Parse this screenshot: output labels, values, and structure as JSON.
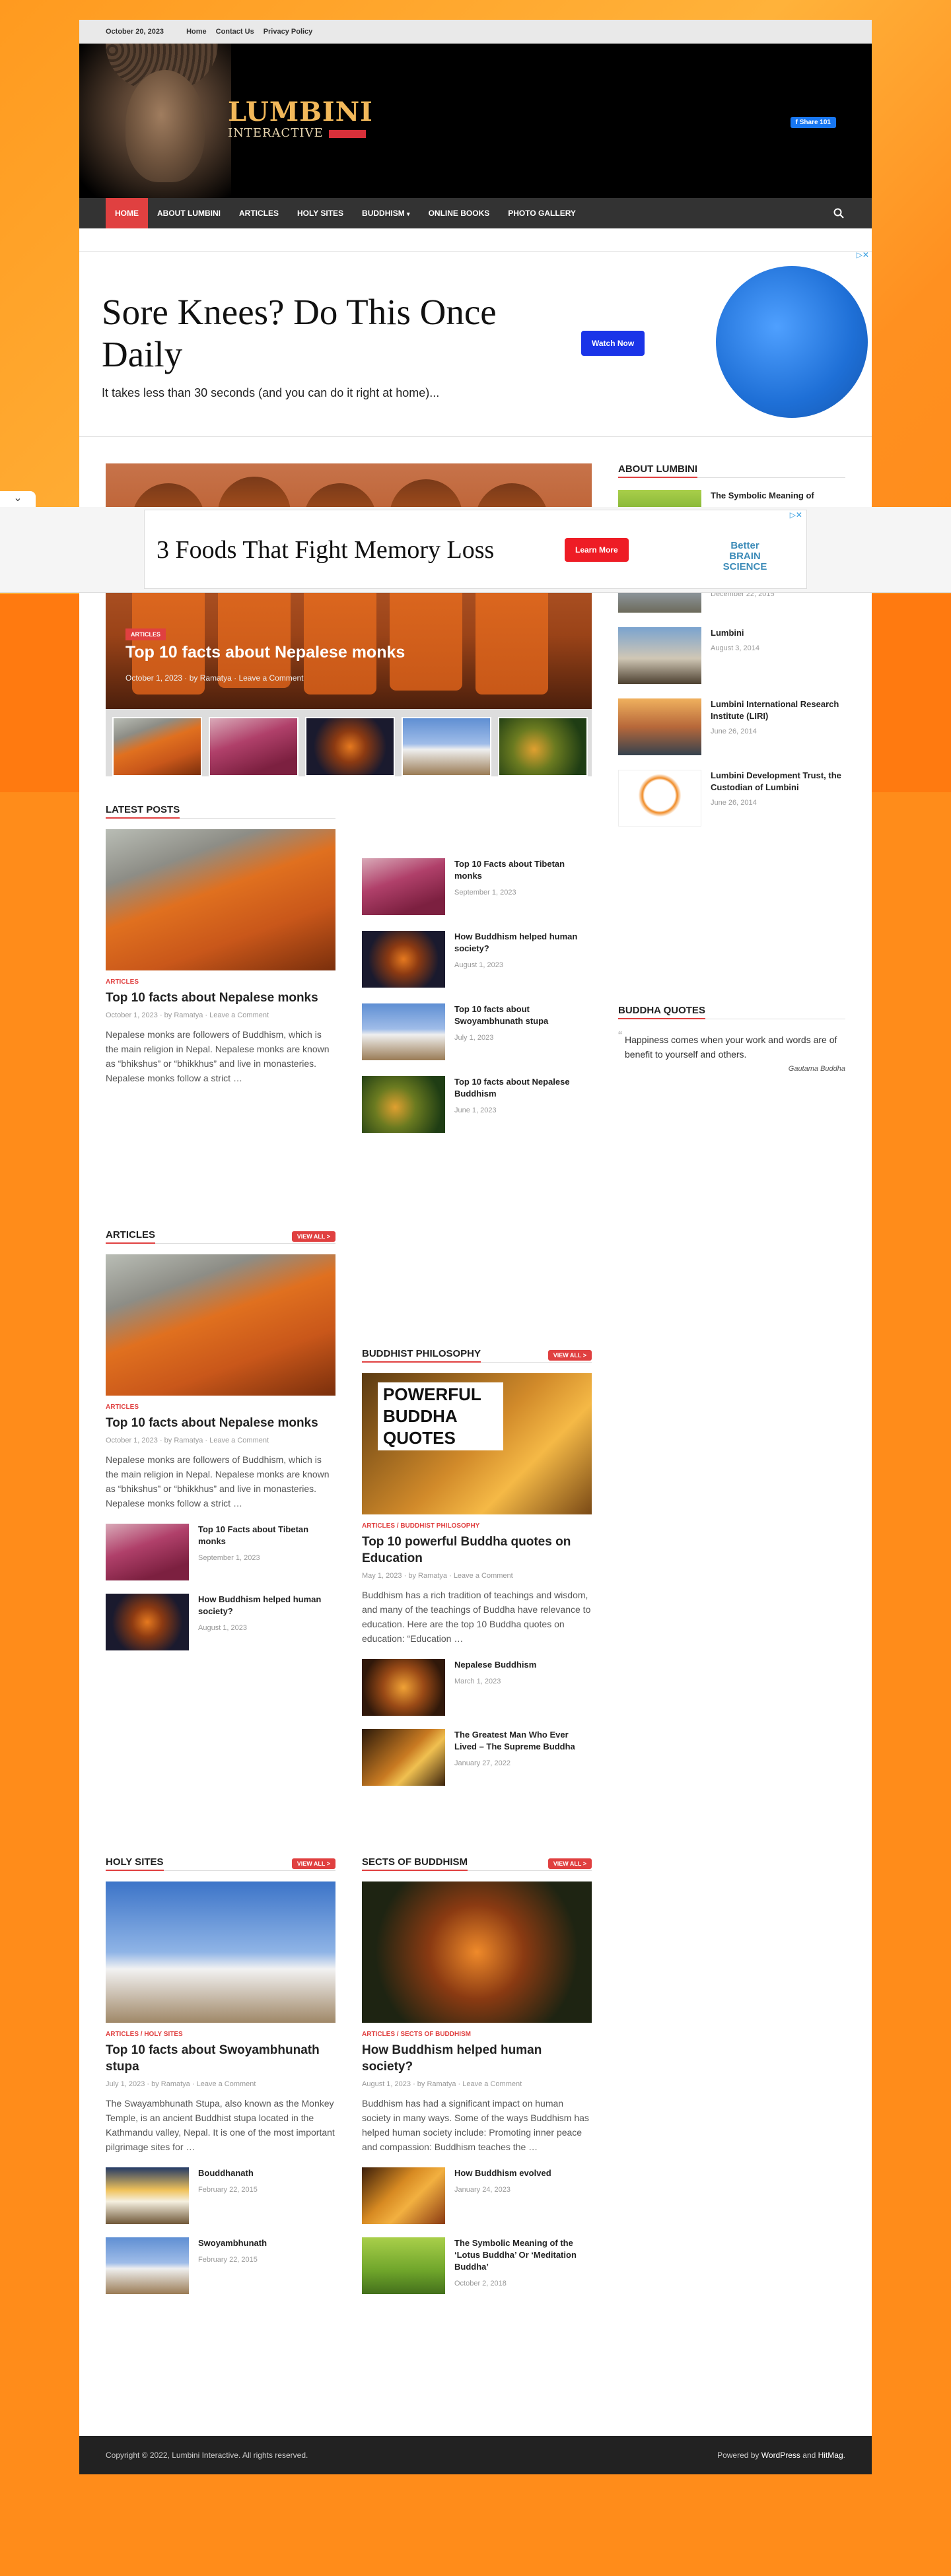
{
  "topbar": {
    "date": "October 20, 2023",
    "links": [
      "Home",
      "Contact Us",
      "Privacy Policy"
    ]
  },
  "header": {
    "logo_line1": "LUMBINI",
    "logo_line2": "INTERACTIVE",
    "share_label": "Share 101"
  },
  "nav": {
    "items": [
      "HOME",
      "ABOUT LUMBINI",
      "ARTICLES",
      "HOLY SITES",
      "BUDDHISM",
      "ONLINE BOOKS",
      "PHOTO GALLERY"
    ],
    "dropdown_icon": "chevron-down-icon",
    "search_icon": "search-icon"
  },
  "ad_top": {
    "headline": "Sore Knees? Do This Once Daily",
    "sub": "It takes less than 30 seconds (and you can do it right at home)...",
    "button": "Watch Now"
  },
  "hero": {
    "category": "ARTICLES",
    "title": "Top 10 facts about Nepalese monks",
    "date": "October 1, 2023",
    "author": "by Ramatya",
    "comment": "Leave a Comment"
  },
  "ad_overlay": {
    "headline": "3 Foods That Fight Memory Loss",
    "button": "Learn More",
    "brand": "Better BRAIN SCIENCE"
  },
  "sidebar": {
    "about_title": "ABOUT LUMBINI",
    "about_items": [
      {
        "title": "The Symbolic Meaning of",
        "date": ""
      },
      {
        "title": "",
        "date": "December 22, 2015"
      },
      {
        "title": "Lumbini",
        "date": "August 3, 2014"
      },
      {
        "title": "Lumbini International Research Institute (LIRI)",
        "date": "June 26, 2014"
      },
      {
        "title": "Lumbini Development Trust, the Custodian of Lumbini",
        "date": "June 26, 2014"
      }
    ],
    "quotes_title": "BUDDHA QUOTES",
    "quote_text": "Happiness comes when your work and words are of benefit to yourself and others.",
    "quote_author": "Gautama Buddha"
  },
  "latest": {
    "title": "LATEST POSTS",
    "main": {
      "category": "ARTICLES",
      "title": "Top 10 facts about Nepalese monks",
      "date": "October 1, 2023",
      "author": "by Ramatya",
      "comment": "Leave a Comment",
      "excerpt": "Nepalese monks are followers of Buddhism, which is the main religion in Nepal. Nepalese monks are known as “bhikshus” or “bhikkhus” and live in monasteries. Nepalese monks follow a strict …"
    },
    "list": [
      {
        "title": "Top 10 Facts about Tibetan monks",
        "date": "September 1, 2023"
      },
      {
        "title": "How Buddhism helped human society?",
        "date": "August 1, 2023"
      },
      {
        "title": "Top 10 facts about Swoyambhunath stupa",
        "date": "July 1, 2023"
      },
      {
        "title": "Top 10 facts about Nepalese Buddhism",
        "date": "June 1, 2023"
      }
    ]
  },
  "articles": {
    "title": "ARTICLES",
    "view_all": "VIEW ALL >",
    "main": {
      "category": "ARTICLES",
      "title": "Top 10 facts about Nepalese monks",
      "date": "October 1, 2023",
      "author": "by Ramatya",
      "comment": "Leave a Comment",
      "excerpt": "Nepalese monks are followers of Buddhism, which is the main religion in Nepal. Nepalese monks are known as “bhikshus” or “bhikkhus” and live in monasteries. Nepalese monks follow a strict …"
    },
    "list": [
      {
        "title": "Top 10 Facts about Tibetan monks",
        "date": "September 1, 2023"
      },
      {
        "title": "How Buddhism helped human society?",
        "date": "August 1, 2023"
      }
    ]
  },
  "philosophy": {
    "title": "BUDDHIST PHILOSOPHY",
    "view_all": "VIEW ALL >",
    "image_text": "POWERFUL BUDDHA QUOTES",
    "main": {
      "category": "ARTICLES / BUDDHIST PHILOSOPHY",
      "title": "Top 10 powerful Buddha quotes on Education",
      "date": "May 1, 2023",
      "author": "by Ramatya",
      "comment": "Leave a Comment",
      "excerpt": "Buddhism has a rich tradition of teachings and wisdom, and many of the teachings of Buddha have relevance to education. Here are the top 10 Buddha quotes on education: “Education …"
    },
    "list": [
      {
        "title": "Nepalese Buddhism",
        "date": "March 1, 2023"
      },
      {
        "title": "The Greatest Man Who Ever Lived – The Supreme Buddha",
        "date": "January 27, 2022"
      }
    ]
  },
  "holy": {
    "title": "HOLY SITES",
    "view_all": "VIEW ALL >",
    "main": {
      "category": "ARTICLES / HOLY SITES",
      "title": "Top 10 facts about Swoyambhunath stupa",
      "date": "July 1, 2023",
      "author": "by Ramatya",
      "comment": "Leave a Comment",
      "excerpt": "The Swayambhunath Stupa, also known as the Monkey Temple, is an ancient Buddhist stupa located in the Kathmandu valley, Nepal. It is one of the most important pilgrimage sites for …"
    },
    "list": [
      {
        "title": "Bouddhanath",
        "date": "February 22, 2015"
      },
      {
        "title": "Swoyambhunath",
        "date": "February 22, 2015"
      }
    ]
  },
  "sects": {
    "title": "SECTS OF BUDDHISM",
    "view_all": "VIEW ALL >",
    "main": {
      "category": "ARTICLES / SECTS OF BUDDHISM",
      "title": "How Buddhism helped human society?",
      "date": "August 1, 2023",
      "author": "by Ramatya",
      "comment": "Leave a Comment",
      "excerpt": "Buddhism has had a significant impact on human society in many ways. Some of the ways Buddhism has helped human society include: Promoting inner peace and compassion: Buddhism teaches the …"
    },
    "list": [
      {
        "title": "How Buddhism evolved",
        "date": "January 24, 2023"
      },
      {
        "title": "The Symbolic Meaning of the ‘Lotus Buddha’ Or ‘Meditation Buddha’",
        "date": "October 2, 2018"
      }
    ]
  },
  "footer": {
    "copyright": "Copyright © 2022, Lumbini Interactive. All rights reserved.",
    "powered_prefix": "Powered by",
    "wp": "WordPress",
    "and": "and",
    "hitmag": "HitMag",
    "suffix": "."
  }
}
